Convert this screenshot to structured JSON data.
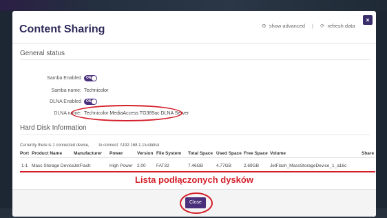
{
  "modal": {
    "title": "Content Sharing",
    "show_advanced": "show advanced",
    "separator": "|",
    "refresh_data": "refresh data",
    "close_x": "×"
  },
  "general_status": {
    "heading": "General status",
    "samba_enabled_label": "Samba Enabled",
    "samba_enabled_toggle": "ON",
    "samba_name_label": "Samba name:",
    "samba_name_value": "Technicolor",
    "dlna_enabled_label": "DLNA Enabled",
    "dlna_enabled_toggle": "ON",
    "dlna_name_label": "DLNA name:",
    "dlna_name_value": "Technicolor MediaAccess TG389ac DLNA Server"
  },
  "hard_disk": {
    "heading": "Hard Disk Information",
    "connected_text": "Currently there is 1 connected device,",
    "connect_path": "to connect: \\\\192.168.1.1\\usbdisk",
    "columns": [
      "Port",
      "Product Name",
      "Manufacturer",
      "Power",
      "Version",
      "File System",
      "Total Space",
      "Used Space",
      "Free Space",
      "Volume",
      "Share"
    ],
    "rows": [
      [
        "1-1",
        "Mass Storage Device",
        "JetFlash",
        "High Power",
        "2.00",
        "FAT32",
        "7.46GB",
        "4.77GB",
        "2.69GB",
        "JetFlash_MassStorageDevice_1_a16c",
        ""
      ]
    ]
  },
  "annotation": "Lista podłączonych dysków",
  "footer": {
    "close_label": "Close"
  },
  "colors": {
    "accent_purple": "#4a2f7a",
    "title_color": "#2f2a5a",
    "annotation_red": "#d41f2a"
  }
}
